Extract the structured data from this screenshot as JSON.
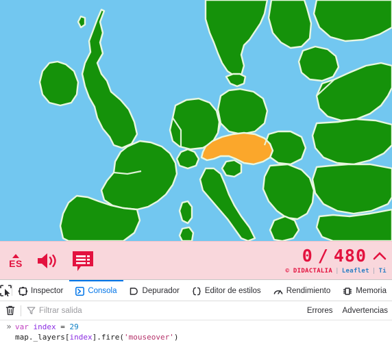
{
  "map": {
    "type": "leaflet-europe-political",
    "colors": {
      "sea": "#72c7f0",
      "land": "#15920a",
      "highlight": "#fba72b",
      "border": "#e8f7e0"
    },
    "highlighted_region": "Austria",
    "attribution": {
      "copyright": "© DIDACTALIA",
      "separator1": "|",
      "leaflet": "Leaflet",
      "separator2": "|",
      "truncated": "Ti"
    }
  },
  "game_bar": {
    "language_label": "ES",
    "language_caret": "caret-up-icon",
    "sound_icon": "speaker-on-icon",
    "messages_icon": "message-list-icon",
    "score_current": "0",
    "score_separator": "/",
    "score_total": "480",
    "collapse_icon": "chevron-up-icon"
  },
  "devtools": {
    "picker_icon": "element-picker-icon",
    "tabs": [
      {
        "label": "Inspector",
        "icon": "inspector-icon",
        "active": false
      },
      {
        "label": "Consola",
        "icon": "console-icon",
        "active": true
      },
      {
        "label": "Depurador",
        "icon": "debugger-icon",
        "active": false
      },
      {
        "label": "Editor de estilos",
        "icon": "style-editor-icon",
        "active": false
      },
      {
        "label": "Rendimiento",
        "icon": "performance-icon",
        "active": false
      },
      {
        "label": "Memoria",
        "icon": "memory-icon",
        "active": false
      }
    ],
    "console_toolbar": {
      "trash_icon": "trash-icon",
      "filter_icon": "funnel-icon",
      "filter_placeholder": "Filtrar salida",
      "filter_value": "",
      "chips": [
        {
          "label": "Errores"
        },
        {
          "label": "Advertencias"
        }
      ]
    },
    "console_output": {
      "prompt_arrow": "»",
      "line1": {
        "keyword": "var",
        "space1": " ",
        "identifier": "index",
        "operator": " = ",
        "number": "29"
      },
      "line2": {
        "object": "map.",
        "property": "_layers",
        "bracket_open": "[",
        "index_var": "index",
        "bracket_close": "]",
        "dot_method": ".fire(",
        "string_arg": "'mouseover'",
        "paren_close": ")"
      }
    }
  },
  "colors": {
    "accent_red": "#e3123f",
    "pink_bar": "#f9d7dc",
    "devtools_blue": "#0074e8"
  }
}
